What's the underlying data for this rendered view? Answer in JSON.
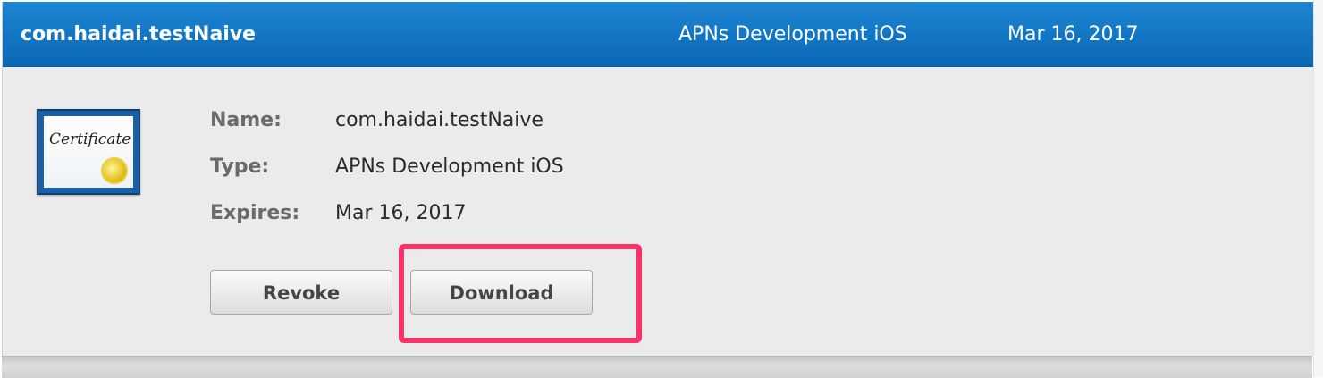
{
  "header": {
    "name": "com.haidai.testNaive",
    "type": "APNs Development iOS",
    "date": "Mar 16, 2017"
  },
  "certificate_icon": {
    "icon": "certificate-icon",
    "text": "Certificate"
  },
  "details": {
    "name_label": "Name:",
    "name_value": "com.haidai.testNaive",
    "type_label": "Type:",
    "type_value": "APNs Development iOS",
    "expires_label": "Expires:",
    "expires_value": "Mar 16, 2017"
  },
  "actions": {
    "revoke_label": "Revoke",
    "download_label": "Download"
  },
  "colors": {
    "header_blue": "#1175c4",
    "highlight": "#fb3268",
    "panel_bg": "#ebebeb"
  }
}
